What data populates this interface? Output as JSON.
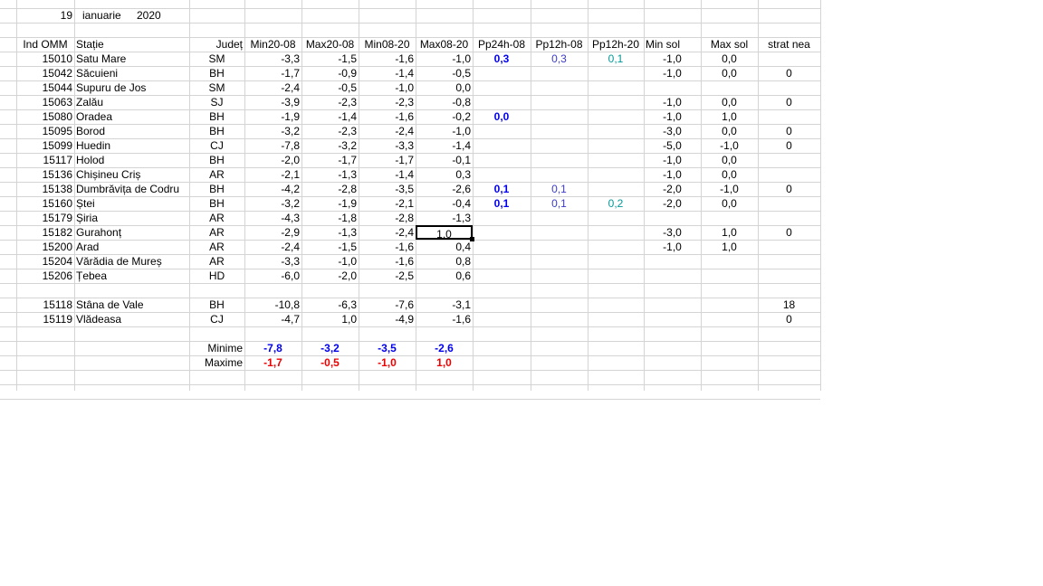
{
  "theme": {
    "grid": "#d4d4d4",
    "blue": "#0000ee",
    "blue_light": "#3a3acc",
    "teal": "#009999",
    "red": "#ee0000"
  },
  "header": {
    "day": "19",
    "month": "ianuarie",
    "year": "2020"
  },
  "columns": [
    "Ind OMM",
    "Stație",
    "Județ",
    "Min20-08",
    "Max20-08",
    "Min08-20",
    "Max08-20",
    "Pp24h-08",
    "Pp12h-08",
    "Pp12h-20",
    "Min sol",
    "Max sol",
    "strat nea"
  ],
  "rows": [
    [
      "15010",
      "Satu Mare",
      "SM",
      "-3,3",
      "-1,5",
      "-1,6",
      "-1,0",
      "0,3",
      "0,3",
      "0,1",
      "-1,0",
      "0,0",
      ""
    ],
    [
      "15042",
      "Săcuieni",
      "BH",
      "-1,7",
      "-0,9",
      "-1,4",
      "-0,5",
      "",
      "",
      "",
      "-1,0",
      "0,0",
      "0"
    ],
    [
      "15044",
      "Supuru de Jos",
      "SM",
      "-2,4",
      "-0,5",
      "-1,0",
      "0,0",
      "",
      "",
      "",
      "",
      "",
      ""
    ],
    [
      "15063",
      "Zalău",
      "SJ",
      "-3,9",
      "-2,3",
      "-2,3",
      "-0,8",
      "",
      "",
      "",
      "-1,0",
      "0,0",
      "0"
    ],
    [
      "15080",
      "Oradea",
      "BH",
      "-1,9",
      "-1,4",
      "-1,6",
      "-0,2",
      "0,0",
      "",
      "",
      "-1,0",
      "1,0",
      ""
    ],
    [
      "15095",
      "Borod",
      "BH",
      "-3,2",
      "-2,3",
      "-2,4",
      "-1,0",
      "",
      "",
      "",
      "-3,0",
      "0,0",
      "0"
    ],
    [
      "15099",
      "Huedin",
      "CJ",
      "-7,8",
      "-3,2",
      "-3,3",
      "-1,4",
      "",
      "",
      "",
      "-5,0",
      "-1,0",
      "0"
    ],
    [
      "15117",
      "Holod",
      "BH",
      "-2,0",
      "-1,7",
      "-1,7",
      "-0,1",
      "",
      "",
      "",
      "-1,0",
      "0,0",
      ""
    ],
    [
      "15136",
      "Chișineu    Criș",
      "AR",
      "-2,1",
      "-1,3",
      "-1,4",
      "0,3",
      "",
      "",
      "",
      "-1,0",
      "0,0",
      ""
    ],
    [
      "15138",
      "Dumbrăvița de Codru",
      "BH",
      "-4,2",
      "-2,8",
      "-3,5",
      "-2,6",
      "0,1",
      "0,1",
      "",
      "-2,0",
      "-1,0",
      "0"
    ],
    [
      "15160",
      "Ștei",
      "BH",
      "-3,2",
      "-1,9",
      "-2,1",
      "-0,4",
      "0,1",
      "0,1",
      "0,2",
      "-2,0",
      "0,0",
      ""
    ],
    [
      "15179",
      "Șiria",
      "AR",
      "-4,3",
      "-1,8",
      "-2,8",
      "-1,3",
      "",
      "",
      "",
      "",
      "",
      ""
    ],
    [
      "15182",
      "Gurahonț",
      "AR",
      "-2,9",
      "-1,3",
      "-2,4",
      "1,0",
      "",
      "",
      "",
      "-3,0",
      "1,0",
      "0"
    ],
    [
      "15200",
      "Arad",
      "AR",
      "-2,4",
      "-1,5",
      "-1,6",
      "0,4",
      "",
      "",
      "",
      "-1,0",
      "1,0",
      ""
    ],
    [
      "15204",
      "Vărădia de Mureș",
      "AR",
      "-3,3",
      "-1,0",
      "-1,6",
      "0,8",
      "",
      "",
      "",
      "",
      "",
      ""
    ],
    [
      "15206",
      "Țebea",
      "HD",
      "-6,0",
      "-2,0",
      "-2,5",
      "0,6",
      "",
      "",
      "",
      "",
      "",
      ""
    ]
  ],
  "mountain_rows": [
    [
      "15118",
      "Stâna de Vale",
      "BH",
      "-10,8",
      "-6,3",
      "-7,6",
      "-3,1",
      "",
      "",
      "",
      "",
      "",
      "18"
    ],
    [
      "15119",
      "Vlădeasa",
      "CJ",
      "-4,7",
      "1,0",
      "-4,9",
      "-1,6",
      "",
      "",
      "",
      "",
      "",
      "0"
    ]
  ],
  "summary": {
    "min_label": "Minime",
    "min": [
      "-7,8",
      "-3,2",
      "-3,5",
      "-2,6"
    ],
    "max_label": "Maxime",
    "max": [
      "-1,7",
      "-0,5",
      "-1,0",
      "1,0"
    ]
  }
}
